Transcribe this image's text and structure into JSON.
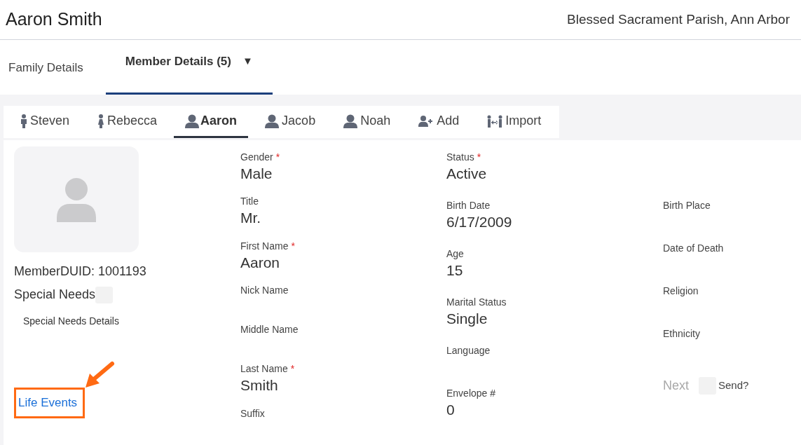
{
  "header": {
    "title": "Aaron Smith",
    "parish": "Blessed Sacrament Parish, Ann Arbor"
  },
  "main_tabs": [
    {
      "label": "Family Details",
      "selected": false
    },
    {
      "label": "Member Details (5)",
      "selected": true,
      "dropdown": "▼"
    }
  ],
  "member_tabs": [
    {
      "label": "Steven",
      "kind": "male",
      "selected": false
    },
    {
      "label": "Rebecca",
      "kind": "female",
      "selected": false
    },
    {
      "label": "Aaron",
      "kind": "person",
      "selected": true
    },
    {
      "label": "Jacob",
      "kind": "person",
      "selected": false
    },
    {
      "label": "Noah",
      "kind": "person",
      "selected": false
    },
    {
      "label": "Add",
      "kind": "add",
      "selected": false
    },
    {
      "label": "Import",
      "kind": "import",
      "selected": false
    }
  ],
  "profile": {
    "member_duid": "MemberDUID: 1001193",
    "special_needs": {
      "label": "Special Needs",
      "checked": false
    },
    "special_needs_details": "Special Needs Details",
    "life_events": "Life Events"
  },
  "columns": [
    [
      {
        "label": "Gender",
        "required_mark": "*",
        "value": "Male"
      },
      {
        "label": "Title",
        "value": "Mr."
      },
      {
        "label": "First Name",
        "required_mark": "*",
        "value": "Aaron"
      },
      {
        "label": "Nick Name"
      },
      {
        "label": "Middle Name"
      },
      {
        "label": "Last Name",
        "required_mark": "*",
        "value": "Smith"
      },
      {
        "label": "Suffix"
      }
    ],
    [
      {
        "label": "Status",
        "required_mark": "*",
        "value": "Active"
      },
      {
        "label": "Birth Date",
        "value": "6/17/2009"
      },
      {
        "label": "Age",
        "value": "15"
      },
      {
        "label": "Marital Status",
        "value": "Single"
      },
      {
        "label": "Language"
      },
      {
        "label": "Envelope #",
        "value": "0"
      }
    ],
    [
      {
        "label": "Birth Place"
      },
      {
        "label": "Date of Death"
      },
      {
        "label": "Religion"
      },
      {
        "label": "Ethnicity"
      }
    ]
  ],
  "footer": {
    "next": {
      "label": "Next",
      "disabled": true
    },
    "send": {
      "label": "Send?",
      "checked": false
    }
  }
}
